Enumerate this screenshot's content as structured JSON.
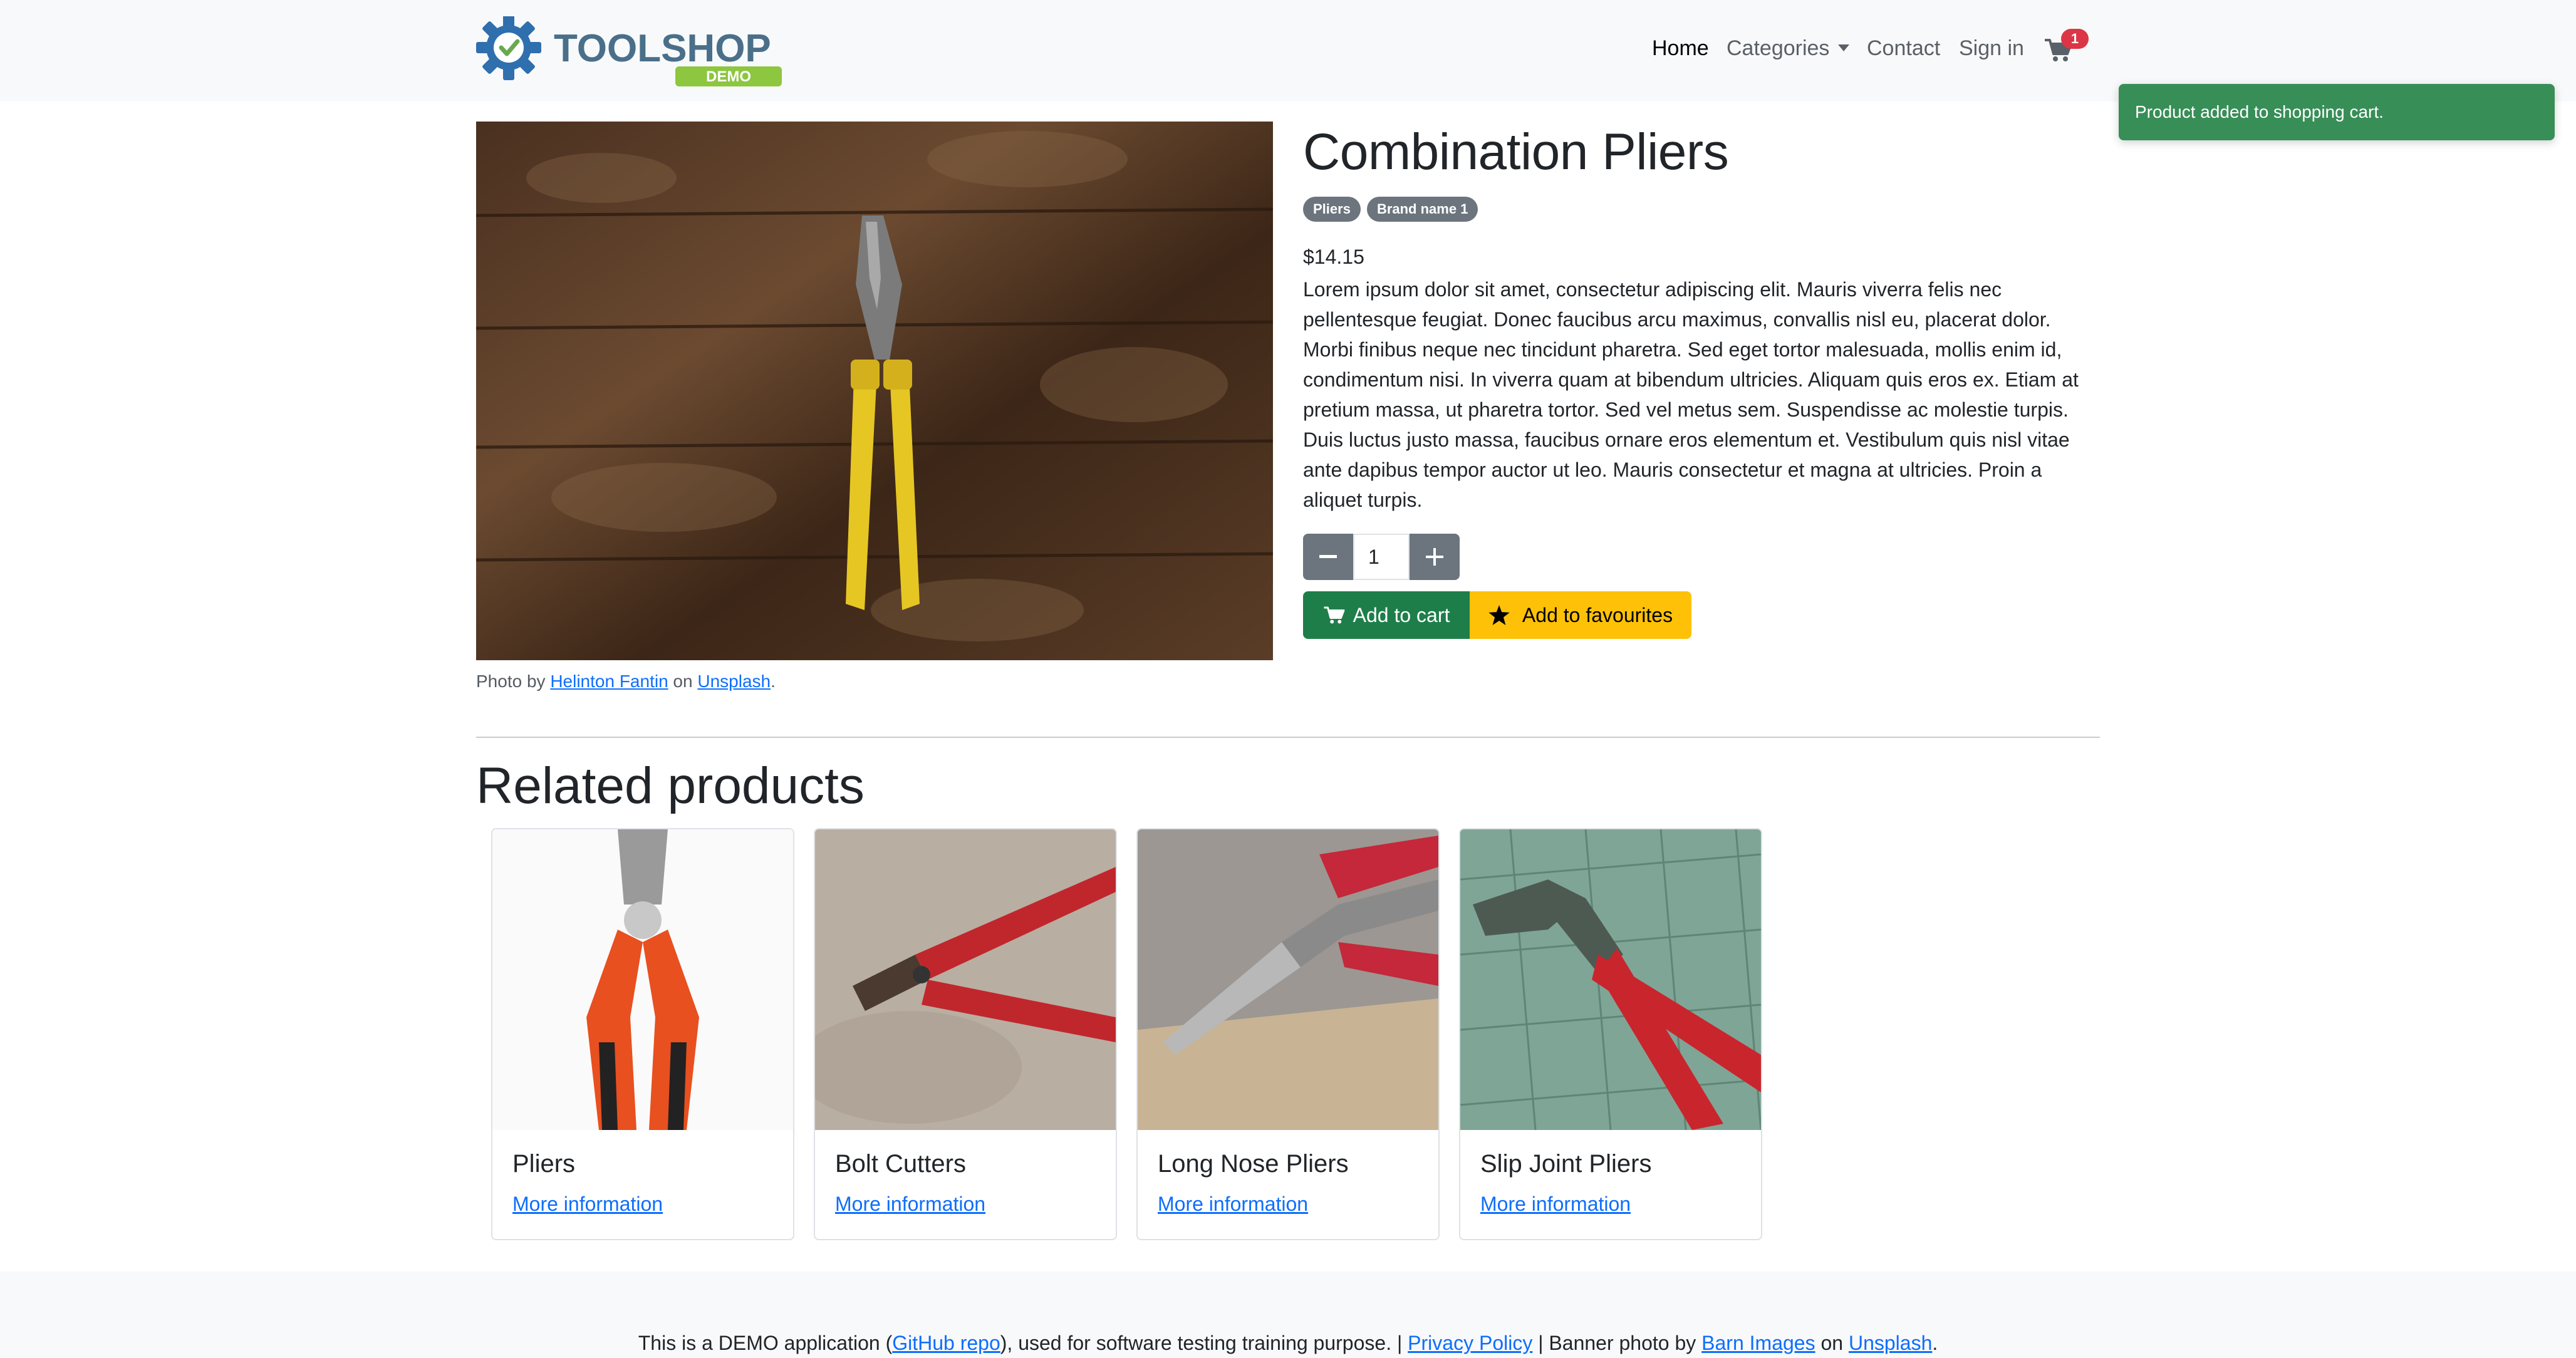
{
  "navbar": {
    "logo_text": "TOOLSHOP",
    "logo_badge": "DEMO",
    "home": "Home",
    "categories": "Categories",
    "contact": "Contact",
    "sign_in": "Sign in",
    "cart_count": "1"
  },
  "toast": {
    "message": "Product added to shopping cart."
  },
  "product": {
    "title": "Combination Pliers",
    "tags": [
      "Pliers",
      "Brand name 1"
    ],
    "price": "$14.15",
    "description": "Lorem ipsum dolor sit amet, consectetur adipiscing elit. Mauris viverra felis nec pellentesque feugiat. Donec faucibus arcu maximus, convallis nisl eu, placerat dolor. Morbi finibus neque nec tincidunt pharetra. Sed eget tortor malesuada, mollis enim id, condimentum nisi. In viverra quam at bibendum ultricies. Aliquam quis eros ex. Etiam at pretium massa, ut pharetra tortor. Sed vel metus sem. Suspendisse ac molestie turpis. Duis luctus justo massa, faucibus ornare eros elementum et. Vestibulum quis nisl vitae ante dapibus tempor auctor ut leo. Mauris consectetur et magna at ultricies. Proin a aliquet turpis.",
    "quantity": "1",
    "add_to_cart": "Add to cart",
    "add_to_favourites": "Add to favourites",
    "photo_credit": {
      "prefix": "Photo by ",
      "author": "Helinton Fantin",
      "middle": " on ",
      "source": "Unsplash",
      "suffix": "."
    }
  },
  "related": {
    "heading": "Related products",
    "items": [
      {
        "name": "Pliers",
        "link": "More information"
      },
      {
        "name": "Bolt Cutters",
        "link": "More information"
      },
      {
        "name": "Long Nose Pliers",
        "link": "More information"
      },
      {
        "name": "Slip Joint Pliers",
        "link": "More information"
      }
    ]
  },
  "footer": {
    "t1": "This is a DEMO application (",
    "github": "GitHub repo",
    "t2": "), used for software testing training purpose. | ",
    "privacy": "Privacy Policy",
    "t3": " | Banner photo by ",
    "barn": "Barn Images",
    "t4": " on ",
    "unsplash": "Unsplash",
    "t5": "."
  },
  "colors": {
    "primary_link": "#0d6efd",
    "success": "#1e7e4a",
    "warning": "#ffc107",
    "badge_danger": "#dc3545",
    "secondary": "#6c757d"
  },
  "icons": [
    "gear-check-logo-icon",
    "cart-icon",
    "minus-icon",
    "plus-icon",
    "star-icon",
    "chevron-down-icon"
  ]
}
